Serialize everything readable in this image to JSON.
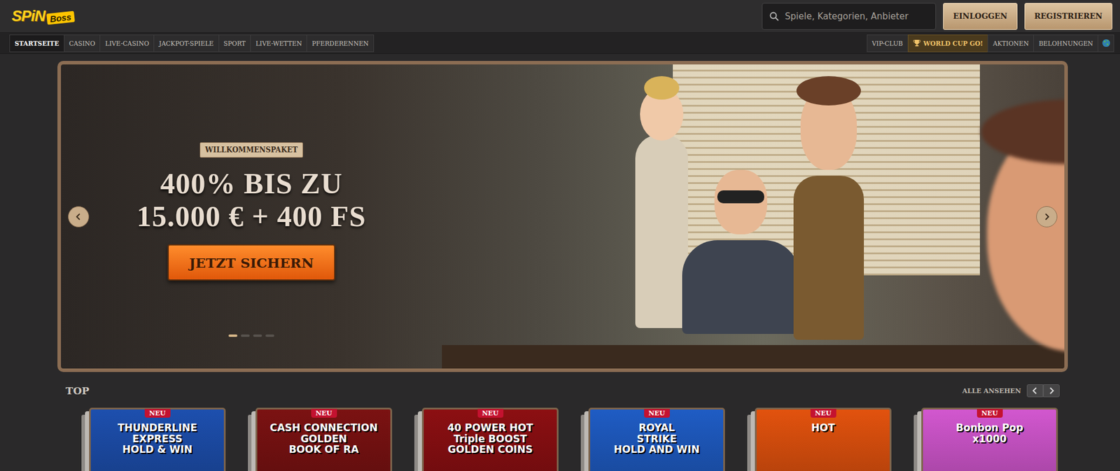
{
  "logo": {
    "word": "SPiN",
    "tag": "Boss"
  },
  "search": {
    "placeholder": "Spiele, Kategorien, Anbieter"
  },
  "auth_buttons": [
    "EINLOGGEN",
    "REGISTRIEREN"
  ],
  "main_nav": [
    {
      "label": "STARTSEITE",
      "selected": true
    },
    {
      "label": "CASINO",
      "selected": false
    },
    {
      "label": "LIVE-CASINO",
      "selected": false
    },
    {
      "label": "JACKPOT-SPIELE",
      "selected": false
    },
    {
      "label": "SPORT",
      "selected": false
    },
    {
      "label": "LIVE-WETTEN",
      "selected": false
    },
    {
      "label": "PFERDERENNEN",
      "selected": false
    }
  ],
  "secondary_nav": [
    {
      "label": "VIP-CLUB",
      "highlighted": false
    },
    {
      "label": "WORLD CUP GO!",
      "highlighted": true
    },
    {
      "label": "AKTIONEN",
      "highlighted": false
    },
    {
      "label": "BELOHNUNGEN",
      "highlighted": false
    }
  ],
  "hero": {
    "tag": "WILLKOMMENSPAKET",
    "headline": [
      "400% BIS ZU",
      "15.000 € + 400 FS"
    ],
    "cta": "JETZT SICHERN",
    "slides": [
      {
        "selected": true
      },
      {
        "selected": false
      },
      {
        "selected": false
      },
      {
        "selected": false
      }
    ]
  },
  "section": {
    "title": "TOP",
    "view_all": "ALLE ANSEHEN"
  },
  "games": [
    {
      "badge": "NEU",
      "title": [
        "THUNDERLINE",
        "EXPRESS",
        "HOLD & WIN"
      ],
      "color": "#1d4fae"
    },
    {
      "badge": "NEU",
      "title": [
        "CASH CONNECTION",
        "GOLDEN",
        "BOOK OF RA"
      ],
      "color": "#7b1212"
    },
    {
      "badge": "NEU",
      "title": [
        "40 POWER HOT",
        "Triple BOOST",
        "GOLDEN COINS"
      ],
      "color": "#8c0f12"
    },
    {
      "badge": "NEU",
      "title": [
        "ROYAL",
        "STRIKE",
        "HOLD AND WIN"
      ],
      "color": "#1f5cc4"
    },
    {
      "badge": "NEU",
      "title": [
        "HOT"
      ],
      "color": "#e2520e"
    },
    {
      "badge": "NEU",
      "title": [
        "Bonbon Pop",
        "x1000"
      ],
      "color": "#d257cf"
    }
  ]
}
